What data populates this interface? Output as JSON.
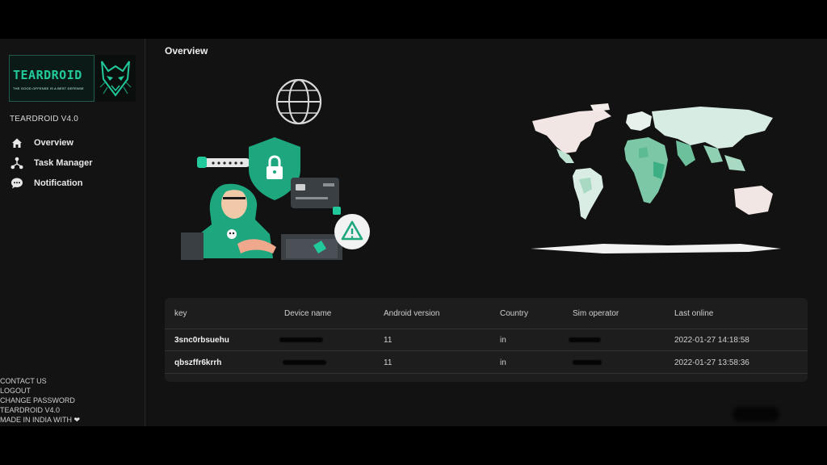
{
  "app": {
    "logo_title": "TEARDROID",
    "logo_tagline": "THE GOOD OFFENSE IS A BEST DEFENSE",
    "version": "TEARDROID V4.0"
  },
  "sidebar": {
    "items": [
      {
        "label": "Overview",
        "icon": "home-icon"
      },
      {
        "label": "Task Manager",
        "icon": "network-icon"
      },
      {
        "label": "Notification",
        "icon": "chat-bubble-icon"
      }
    ],
    "footer": [
      "CONTACT US",
      "LOGOUT",
      "CHANGE PASSWORD",
      "TEARDROID V4.0",
      "MADE IN INDIA WITH"
    ]
  },
  "main": {
    "title": "Overview",
    "table": {
      "headers": [
        "key",
        "Device name",
        "Android version",
        "Country",
        "Sim operator",
        "Last online"
      ],
      "rows": [
        {
          "key": "3snc0rbsuehu",
          "android": "11",
          "country": "in",
          "last_online": "2022-01-27 14:18:58"
        },
        {
          "key": "qbszffr6krrh",
          "android": "11",
          "country": "in",
          "last_online": "2022-01-27 13:58:36"
        }
      ]
    }
  },
  "colors": {
    "accent": "#22c99a",
    "background": "#121212",
    "panel": "#1d1d1d"
  }
}
